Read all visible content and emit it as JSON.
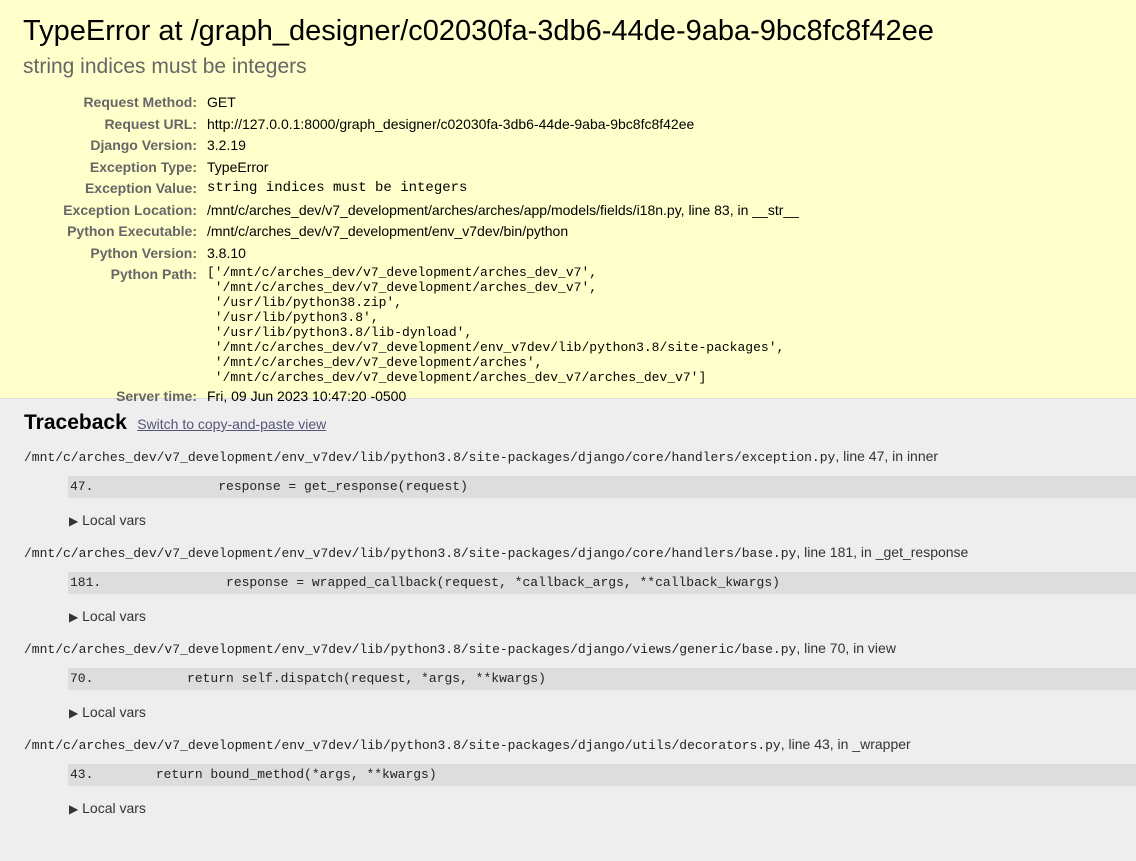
{
  "summary": {
    "title": "TypeError at /graph_designer/c02030fa-3db6-44de-9aba-9bc8fc8f42ee",
    "subtitle": "string indices must be integers",
    "meta": [
      {
        "label": "Request Method:",
        "value": "GET",
        "mono": false
      },
      {
        "label": "Request URL:",
        "value": "http://127.0.0.1:8000/graph_designer/c02030fa-3db6-44de-9aba-9bc8fc8f42ee",
        "mono": false
      },
      {
        "label": "Django Version:",
        "value": "3.2.19",
        "mono": false
      },
      {
        "label": "Exception Type:",
        "value": "TypeError",
        "mono": false
      },
      {
        "label": "Exception Value:",
        "value": "string indices must be integers",
        "mono": true
      },
      {
        "label": "Exception Location:",
        "value": "/mnt/c/arches_dev/v7_development/arches/arches/app/models/fields/i18n.py, line 83, in __str__",
        "mono": false
      },
      {
        "label": "Python Executable:",
        "value": "/mnt/c/arches_dev/v7_development/env_v7dev/bin/python",
        "mono": false
      },
      {
        "label": "Python Version:",
        "value": "3.8.10",
        "mono": false
      }
    ],
    "python_path_label": "Python Path:",
    "python_path": "['/mnt/c/arches_dev/v7_development/arches_dev_v7',\n '/mnt/c/arches_dev/v7_development/arches_dev_v7',\n '/usr/lib/python38.zip',\n '/usr/lib/python3.8',\n '/usr/lib/python3.8/lib-dynload',\n '/mnt/c/arches_dev/v7_development/env_v7dev/lib/python3.8/site-packages',\n '/mnt/c/arches_dev/v7_development/arches',\n '/mnt/c/arches_dev/v7_development/arches_dev_v7/arches_dev_v7']",
    "server_time_label": "Server time:",
    "server_time": "Fri, 09 Jun 2023 10:47:20 -0500"
  },
  "traceback": {
    "heading": "Traceback",
    "switch_link": "Switch to copy-and-paste view",
    "local_vars_label": "Local vars",
    "frames": [
      {
        "file": "/mnt/c/arches_dev/v7_development/env_v7dev/lib/python3.8/site-packages/django/core/handlers/exception.py",
        "info": ", line 47, in inner",
        "code": "47.                response = get_response(request)"
      },
      {
        "file": "/mnt/c/arches_dev/v7_development/env_v7dev/lib/python3.8/site-packages/django/core/handlers/base.py",
        "info": ", line 181, in _get_response",
        "code": "181.                response = wrapped_callback(request, *callback_args, **callback_kwargs)"
      },
      {
        "file": "/mnt/c/arches_dev/v7_development/env_v7dev/lib/python3.8/site-packages/django/views/generic/base.py",
        "info": ", line 70, in view",
        "code": "70.            return self.dispatch(request, *args, **kwargs)"
      },
      {
        "file": "/mnt/c/arches_dev/v7_development/env_v7dev/lib/python3.8/site-packages/django/utils/decorators.py",
        "info": ", line 43, in _wrapper",
        "code": "43.        return bound_method(*args, **kwargs)"
      }
    ]
  }
}
